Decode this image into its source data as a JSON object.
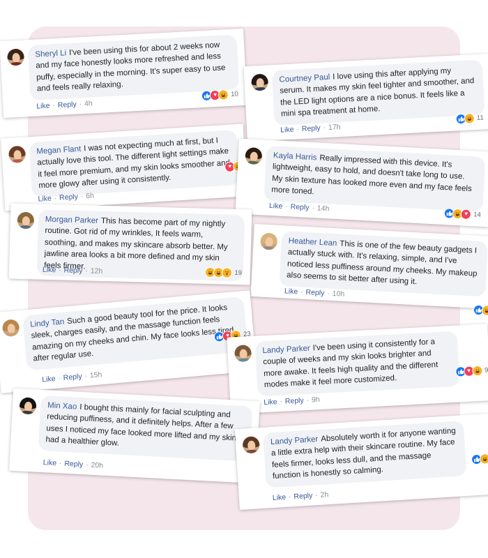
{
  "comments": [
    {
      "name": "Sheryl Li",
      "text": "I've been using this for about 2 weeks now and my face honestly looks more refreshed and less puffy, especially in the morning. It's super easy to use and feels really relaxing.",
      "like": "Like",
      "reply": "Reply",
      "time": "4h",
      "count": "10",
      "avatar_hair": "#3b2418",
      "avatar_shirt": "#7a2a2a"
    },
    {
      "name": "Courtney Paul",
      "text": "I love using this after applying my serum. It makes my skin feel tighter and smoother, and the LED light options are a nice bonus. It feels like a mini spa treatment at home.",
      "like": "Like",
      "reply": "Reply",
      "time": "17h",
      "count": "11",
      "avatar_hair": "#1f1a17",
      "avatar_shirt": "#2f3d55"
    },
    {
      "name": "Megan Flant",
      "text": "I was not expecting much at first, but I actually love this tool. The different light settings make it feel more premium, and my skin looks smoother and more glowy after using it consistently.",
      "like": "Like",
      "reply": "Reply",
      "time": "6h",
      "count": "",
      "avatar_hair": "#6b3c24",
      "avatar_shirt": "#b85c4a"
    },
    {
      "name": "Kayla Harris",
      "text": "Really impressed with this device. It's lightweight, easy to hold, and doesn't take long to use. My skin texture has looked more even and my face feels more toned.",
      "like": "Like",
      "reply": "Reply",
      "time": "14h",
      "count": "14",
      "avatar_hair": "#2b1c12",
      "avatar_shirt": "#5a6a4a"
    },
    {
      "name": "Morgan Parker",
      "text": "This has become part of my nightly routine. Got rid of my wrinkles, It feels warm, soothing, and makes my skincare absorb better. My jawline area looks a bit more defined and my skin feels firmer.",
      "like": "Like",
      "reply": "Reply",
      "time": "12h",
      "count": "19",
      "avatar_hair": "#8a6a3c",
      "avatar_shirt": "#5a6b7a"
    },
    {
      "name": "Heather Lean",
      "text": "This is one of the few beauty gadgets I actually stuck with. It's relaxing, simple, and I've noticed less puffiness around my cheeks. My makeup also seems to sit better after using it.",
      "like": "Like",
      "reply": "Reply",
      "time": "10h",
      "count": "",
      "avatar_hair": "#d8b27a",
      "avatar_shirt": "#9a8a7a"
    },
    {
      "name": "Lindy Tan",
      "text": "Such a good beauty tool for the price. It looks sleek, charges easily, and the massage function feels amazing on my cheeks and chin. My face looks less tired after regular use.",
      "like": "Like",
      "reply": "Reply",
      "time": "15h",
      "count": "23",
      "avatar_hair": "#b9874a",
      "avatar_shirt": "#c9a07a"
    },
    {
      "name": "Landy Parker",
      "text": "I've been using it consistently for a couple of weeks and my skin looks brighter and more awake. It feels high quality and the different modes make it feel more customized.",
      "like": "Like",
      "reply": "Reply",
      "time": "9h",
      "count": "9",
      "avatar_hair": "#7a5a36",
      "avatar_shirt": "#6a8a9a"
    },
    {
      "name": "Min Xao",
      "text": "I bought this mainly for facial sculpting and reducing puffiness, and it definitely helps. After a few uses I noticed my face looked more lifted and my skin had a healthier glow.",
      "like": "Like",
      "reply": "Reply",
      "time": "20h",
      "count": "",
      "avatar_hair": "#141414",
      "avatar_shirt": "#3a3a3a"
    },
    {
      "name": "Landy Parker",
      "text": "Absolutely worth it for anyone wanting a little extra help with their skincare routine. My face feels firmer, looks less dull, and the massage function is honestly so calming.",
      "like": "Like",
      "reply": "Reply",
      "time": "2h",
      "count": "",
      "avatar_hair": "#5a3a24",
      "avatar_shirt": "#7a4a3a"
    }
  ],
  "colors": {
    "panel": "#f5e6ec",
    "name": "#385898",
    "like": "#1877f2",
    "love": "#f33e58",
    "haha": "#f7b125"
  }
}
